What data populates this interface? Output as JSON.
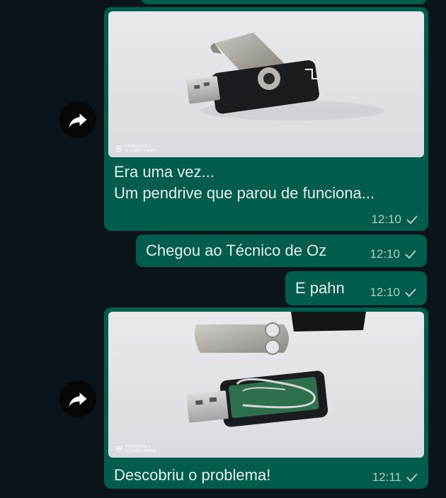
{
  "messages": [
    {
      "kind": "image",
      "caption": "Era uma vez...\nUm pendrive que parou de funciona...",
      "time": "12:10",
      "status": "read-check",
      "photo_watermark": [
        "REDMI NOTE 9",
        "AI QUAD CAMERA"
      ]
    },
    {
      "kind": "text",
      "text": "Chegou ao Técnico de Oz",
      "time": "12:10",
      "status": "read-check"
    },
    {
      "kind": "text",
      "text": "E pahn",
      "time": "12:10",
      "status": "read-check"
    },
    {
      "kind": "image",
      "caption": "Descobriu o problema!",
      "time": "12:11",
      "status": "read-check",
      "photo_watermark": [
        "REDMI NOTE 9",
        "AI QUAD CAMERA"
      ]
    }
  ],
  "icons": {
    "forward": "forward-icon",
    "check": "check-icon"
  },
  "colors": {
    "background": "#0b141a",
    "bubble": "#005c4b",
    "meta": "#b7c9c4"
  }
}
